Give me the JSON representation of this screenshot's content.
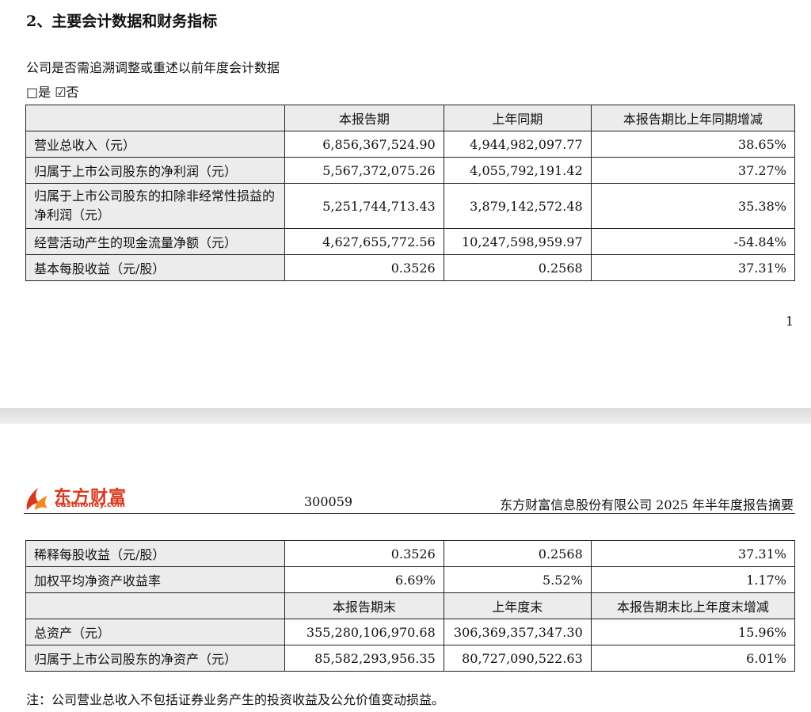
{
  "section": {
    "title": "2、主要会计数据和财务指标",
    "question": "公司是否需追溯调整或重述以前年度会计数据",
    "choice": "□是 ☑否"
  },
  "table1": {
    "headers": [
      "",
      "本报告期",
      "上年同期",
      "本报告期比上年同期增减"
    ],
    "rows": [
      {
        "label": "营业总收入（元）",
        "current": "6,856,367,524.90",
        "prior": "4,944,982,097.77",
        "change": "38.65%"
      },
      {
        "label": "归属于上市公司股东的净利润（元）",
        "current": "5,567,372,075.26",
        "prior": "4,055,792,191.42",
        "change": "37.27%"
      },
      {
        "label": "归属于上市公司股东的扣除非经常性损益的净利润（元）",
        "current": "5,251,744,713.43",
        "prior": "3,879,142,572.48",
        "change": "35.38%"
      },
      {
        "label": "经营活动产生的现金流量净额（元）",
        "current": "4,627,655,772.56",
        "prior": "10,247,598,959.97",
        "change": "-54.84%"
      },
      {
        "label": "基本每股收益（元/股）",
        "current": "0.3526",
        "prior": "0.2568",
        "change": "37.31%"
      }
    ]
  },
  "page_number": "1",
  "page_header": {
    "logo_cn": "东方财富",
    "logo_en": "eastmoney.com",
    "stock_code": "300059",
    "report_title": "东方财富信息股份有限公司 2025 年半年度报告摘要"
  },
  "table2": {
    "rows_top": [
      {
        "label": "稀释每股收益（元/股）",
        "current": "0.3526",
        "prior": "0.2568",
        "change": "37.31%"
      },
      {
        "label": "加权平均净资产收益率",
        "current": "6.69%",
        "prior": "5.52%",
        "change": "1.17%"
      }
    ],
    "headers": [
      "",
      "本报告期末",
      "上年度末",
      "本报告期末比上年度末增减"
    ],
    "rows_bottom": [
      {
        "label": "总资产（元）",
        "current": "355,280,106,970.68",
        "prior": "306,369,357,347.30",
        "change": "15.96%"
      },
      {
        "label": "归属于上市公司股东的净资产（元）",
        "current": "85,582,293,956.35",
        "prior": "80,727,090,522.63",
        "change": "6.01%"
      }
    ]
  },
  "note": "注：公司营业总收入不包括证券业务产生的投资收益及公允价值变动损益。",
  "colors": {
    "header_bg": "#ececec",
    "brand": "#d9381e"
  }
}
